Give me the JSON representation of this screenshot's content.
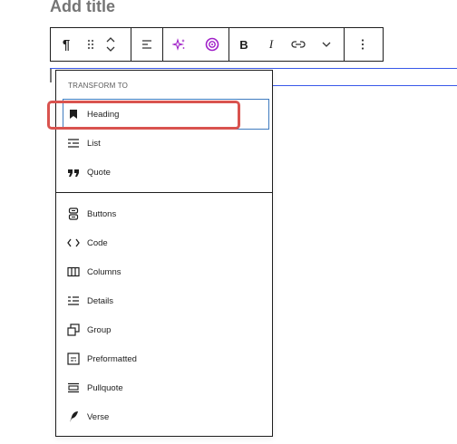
{
  "title": "Add title",
  "toolbar": {
    "paragraph_icon": "¶",
    "bold_label": "B",
    "italic_label": "I"
  },
  "popover": {
    "header": "TRANSFORM TO",
    "items": [
      {
        "label": "Heading",
        "icon": "heading-icon"
      },
      {
        "label": "List",
        "icon": "list-icon"
      },
      {
        "label": "Quote",
        "icon": "quote-icon"
      },
      {
        "label": "Buttons",
        "icon": "buttons-icon"
      },
      {
        "label": "Code",
        "icon": "code-icon"
      },
      {
        "label": "Columns",
        "icon": "columns-icon"
      },
      {
        "label": "Details",
        "icon": "details-icon"
      },
      {
        "label": "Group",
        "icon": "group-icon"
      },
      {
        "label": "Preformatted",
        "icon": "preformatted-icon"
      },
      {
        "label": "Pullquote",
        "icon": "pullquote-icon"
      },
      {
        "label": "Verse",
        "icon": "verse-icon"
      }
    ]
  },
  "colors": {
    "highlight": "#d9534f",
    "ai_accent": "#a020c8",
    "focus_outline": "#3f7bbf"
  }
}
